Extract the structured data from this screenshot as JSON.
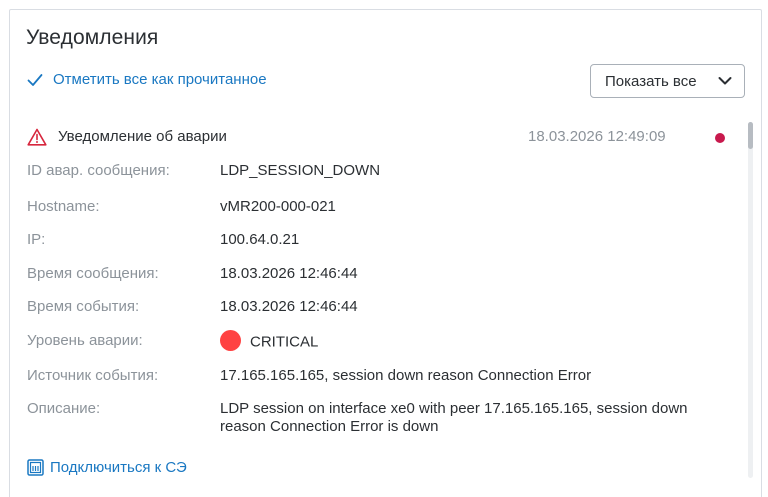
{
  "panel": {
    "title": "Уведомления",
    "mark_all_read": "Отметить все как прочитанное",
    "show_filter": "Показать все"
  },
  "notification": {
    "title": "Уведомление об аварии",
    "timestamp": "18.03.2026 12:49:09",
    "unread": true,
    "fields": [
      {
        "label": "ID авар. сообщения:",
        "value": "LDP_SESSION_DOWN"
      },
      {
        "label": "Hostname:",
        "value": "vMR200-000-021"
      },
      {
        "label": "IP:",
        "value": "100.64.0.21"
      },
      {
        "label": "Время сообщения:",
        "value": "18.03.2026 12:46:44"
      },
      {
        "label": "Время события:",
        "value": "18.03.2026 12:46:44"
      },
      {
        "label": "Уровень аварии:",
        "value": "CRITICAL"
      },
      {
        "label": "Источник события:",
        "value": "17.165.165.165, session down reason Connection Error"
      },
      {
        "label": "Описание:",
        "value": "LDP session on interface xe0 with peer 17.165.165.165, session down reason Connection Error is down"
      }
    ],
    "connect_link": "Подключиться к СЭ"
  },
  "colors": {
    "accent": "#1a78c2",
    "critical": "#ff4242",
    "unread_dot": "#c8194d",
    "warning_icon": "#d7263d"
  },
  "icons": {
    "mark_all": "check-icon",
    "filter": "chevron-down-icon",
    "alarm": "warning-triangle-icon",
    "connect": "terminal-icon"
  }
}
